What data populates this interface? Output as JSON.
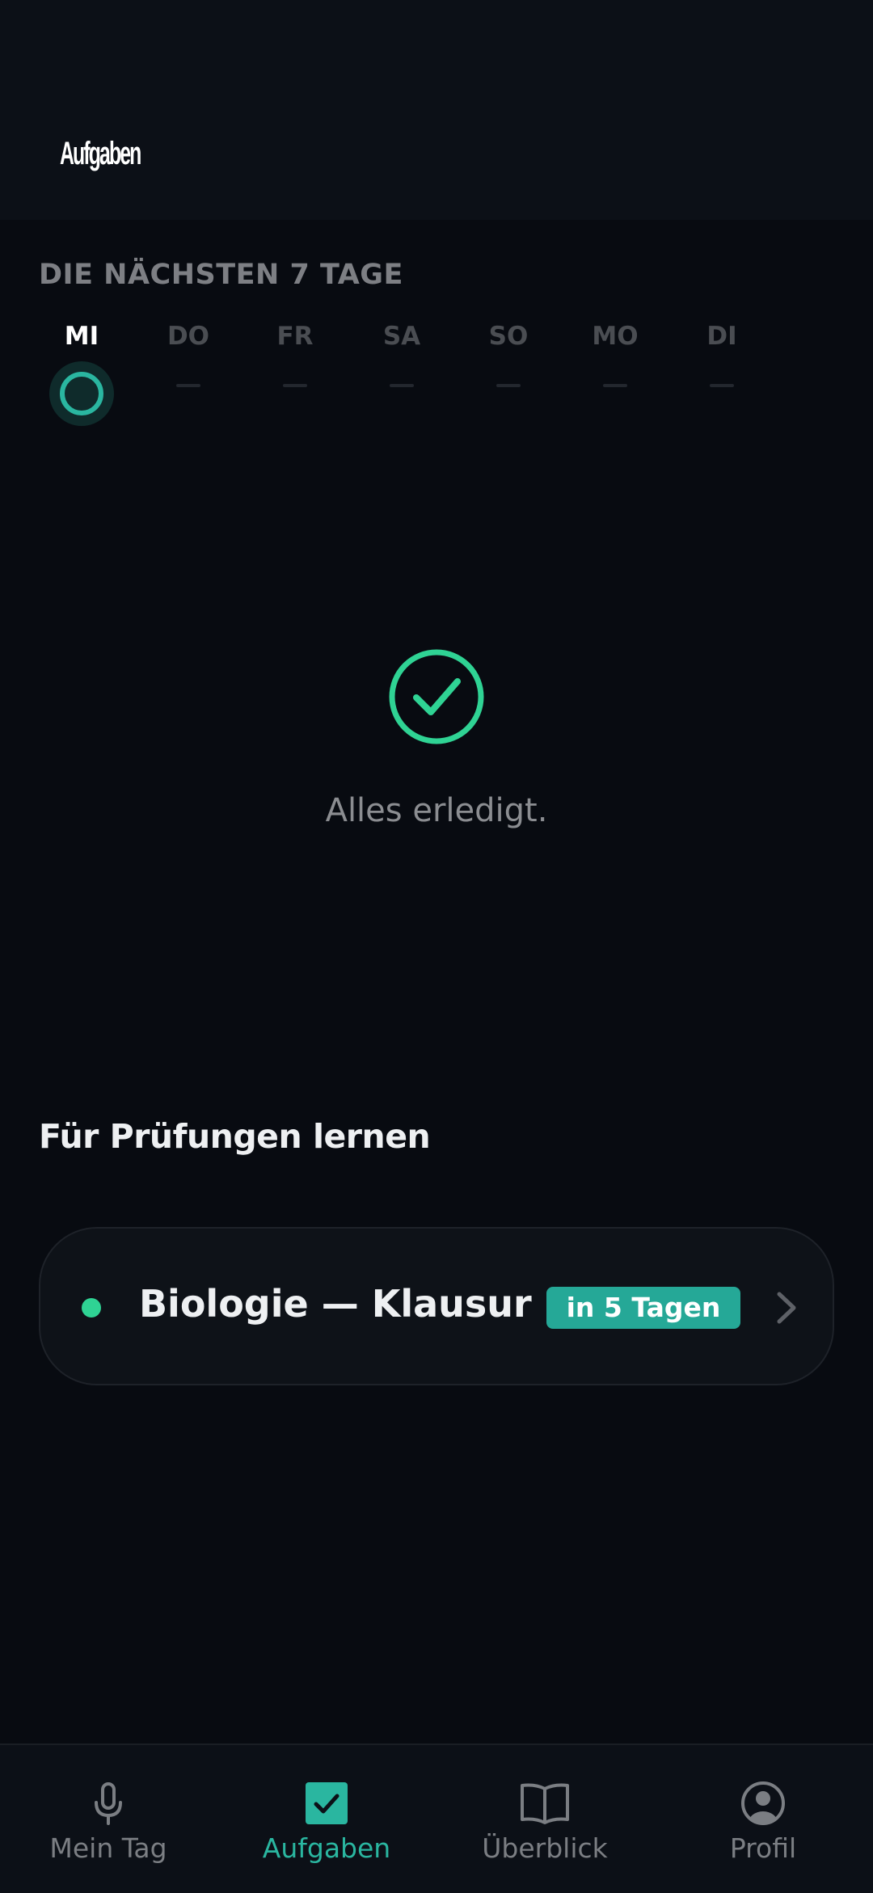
{
  "app_bar": {
    "title": "Aufgaben"
  },
  "week": {
    "caption": "DIE NÄCHSTEN 7 TAGE",
    "days": [
      {
        "label": "MI",
        "active": true
      },
      {
        "label": "DO",
        "active": false
      },
      {
        "label": "FR",
        "active": false
      },
      {
        "label": "SA",
        "active": false
      },
      {
        "label": "SO",
        "active": false
      },
      {
        "label": "MO",
        "active": false
      },
      {
        "label": "DI",
        "active": false
      }
    ]
  },
  "empty_state": {
    "icon": "check-circle-icon",
    "text": "Alles erledigt."
  },
  "exams": {
    "heading": "Für Prüfungen lernen",
    "items": [
      {
        "title": "Biologie — Klausur",
        "badge": "in 5 Tagen",
        "dot_color": "#2fd394"
      }
    ]
  },
  "bottom_nav": {
    "items": [
      {
        "label": "Mein Tag",
        "icon": "microphone-icon",
        "active": false
      },
      {
        "label": "Aufgaben",
        "icon": "checkbox-icon",
        "active": true
      },
      {
        "label": "Überblick",
        "icon": "book-icon",
        "active": false
      },
      {
        "label": "Profil",
        "icon": "user-circle-icon",
        "active": false
      }
    ]
  },
  "colors": {
    "accent": "#2ab6a0",
    "background": "#080b11",
    "surface": "#0c1017",
    "success": "#2fd394"
  }
}
